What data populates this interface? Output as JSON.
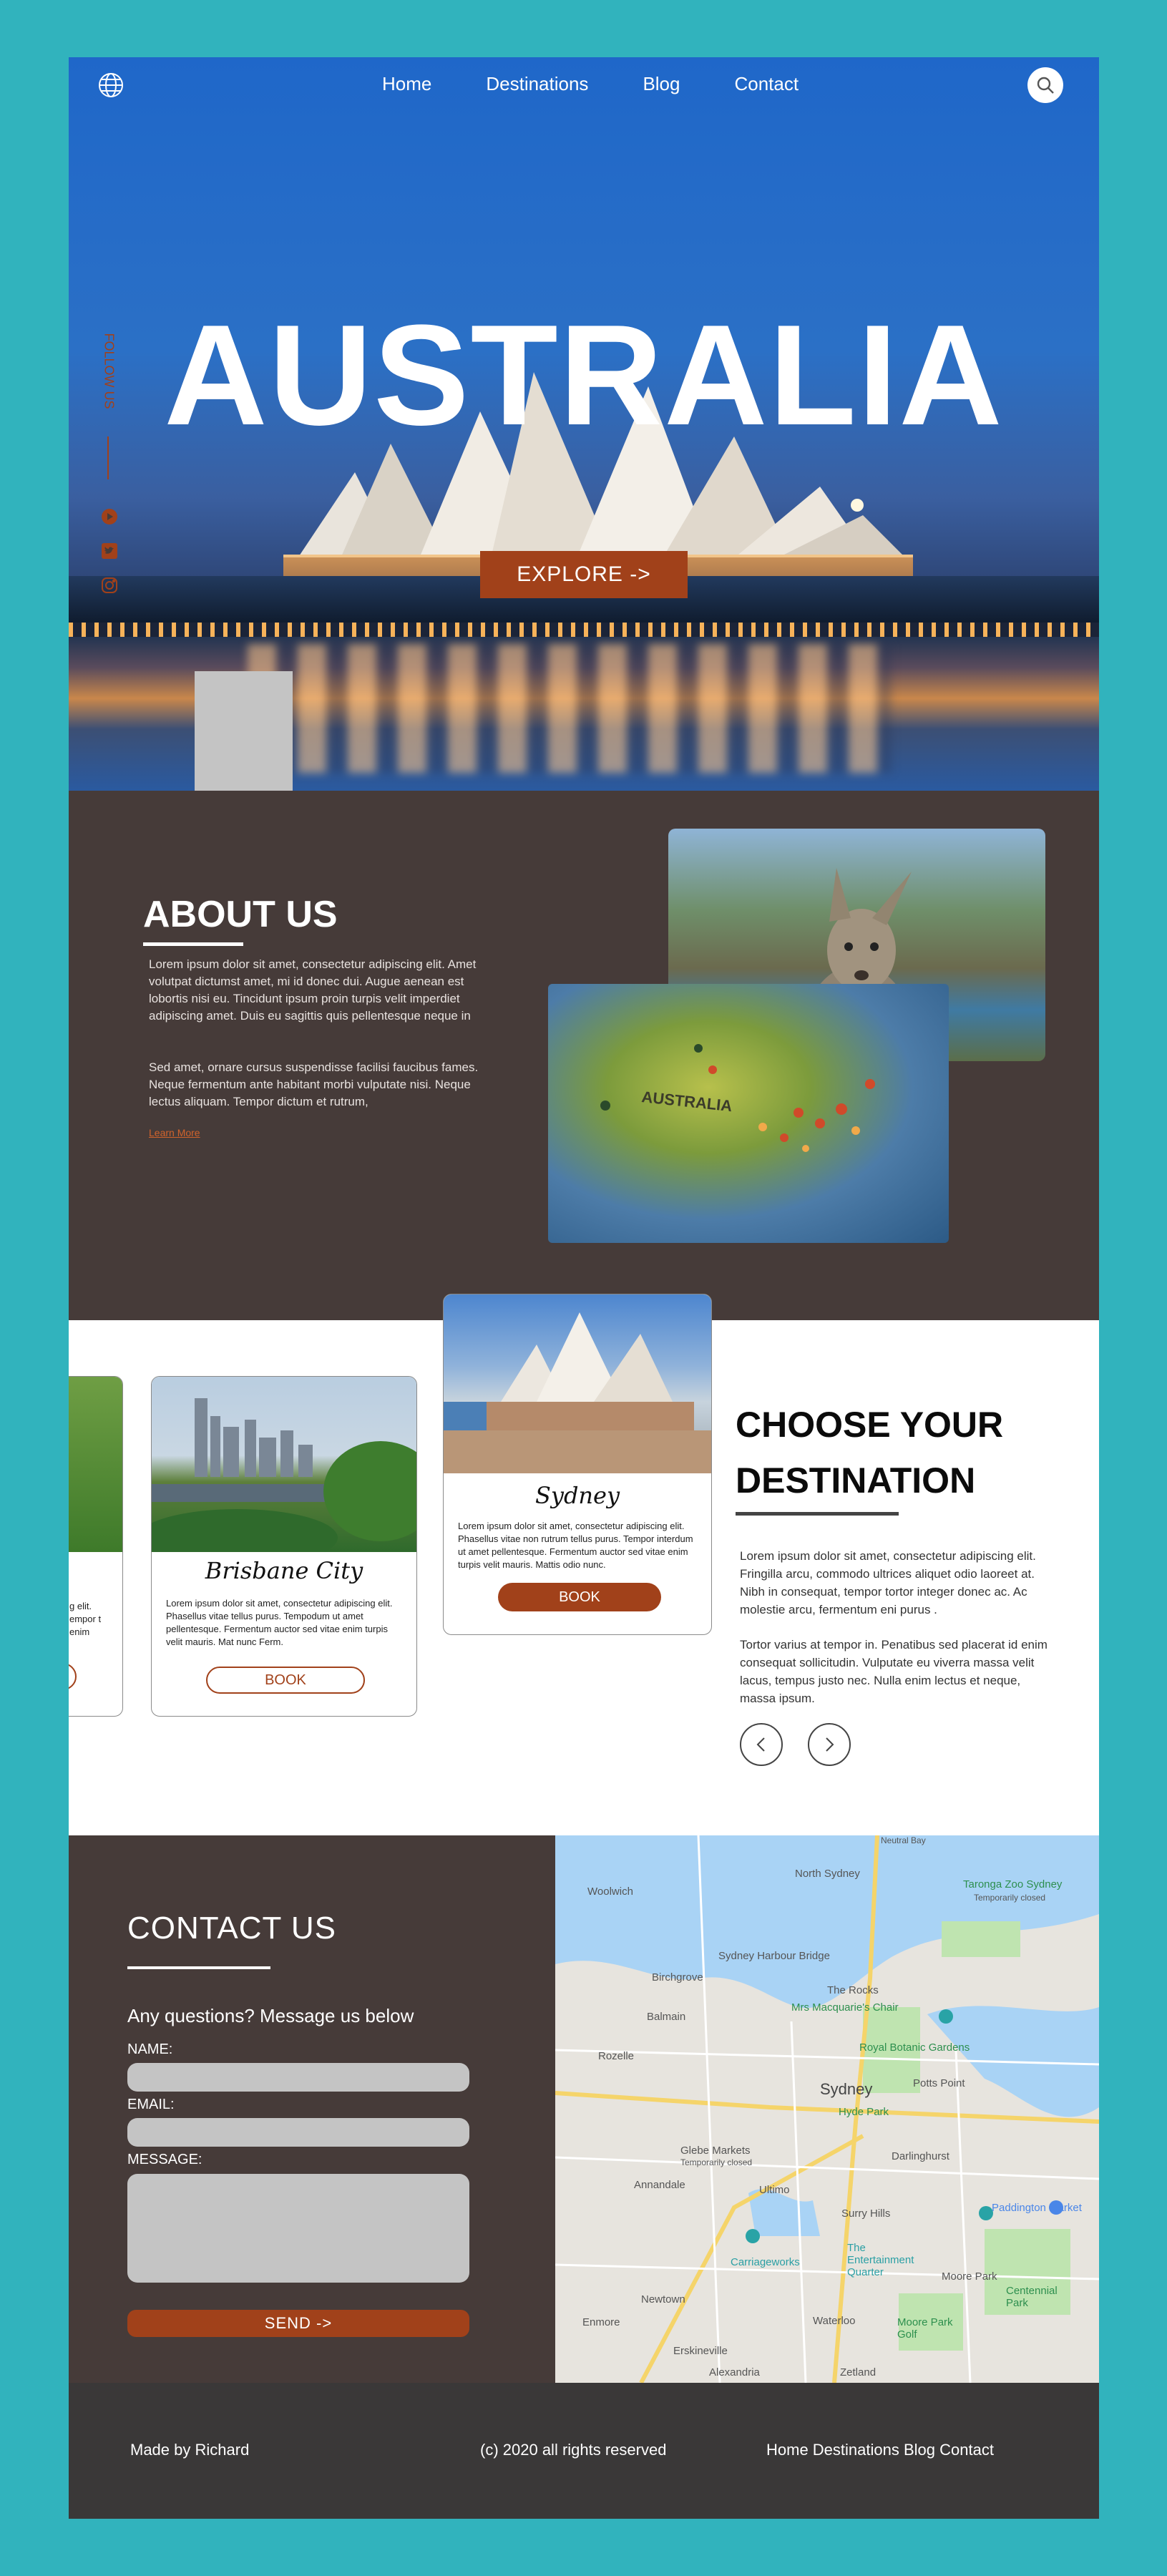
{
  "nav": {
    "links": [
      "Home",
      "Destinations",
      "Blog",
      "Contact"
    ]
  },
  "hero": {
    "title": "AUSTRALIA",
    "explore_label": "EXPLORE ->",
    "follow_label": "FOLLOW US"
  },
  "about": {
    "heading": "ABOUT US",
    "paragraph1": "Lorem ipsum dolor sit amet, consectetur adipiscing elit. Amet volutpat dictumst amet, mi id donec dui. Augue aenean est lobortis nisi eu. Tincidunt ipsum proin turpis velit imperdiet adipiscing amet. Duis eu sagittis quis pellentesque neque in",
    "paragraph2": "Sed amet, ornare cursus suspendisse facilisi faucibus fames. Neque fermentum ante habitant morbi vulputate nisi. Neque lectus aliquam. Tempor dictum et rutrum,",
    "learn_more": "Learn More",
    "map_photo_text": "AUSTRALIA"
  },
  "destinations": {
    "heading_line1": "CHOOSE YOUR",
    "heading_line2": "DESTINATION",
    "paragraph1": "Lorem ipsum dolor sit amet, consectetur adipiscing elit. Fringilla arcu, commodo ultrices aliquet odio laoreet at. Nibh in consequat, tempor tortor integer donec ac. Ac molestie arcu, fermentum eni purus .",
    "paragraph2": "Tortor varius at tempor in. Penatibus sed placerat id enim consequat sollicitudin. Vulputate eu viverra massa velit lacus, tempus justo nec. Nulla enim lectus et neque, massa ipsum.",
    "cards": [
      {
        "name": "",
        "text": "g elit.\nempor\nt enim",
        "book": ""
      },
      {
        "name": "Brisbane City",
        "text": "Lorem ipsum dolor sit amet, consectetur adipiscing elit. Phasellus vitae tellus purus. Tempodum ut amet pellentesque. Fermentum auctor sed vitae enim turpis velit mauris. Mat nunc Ferm.",
        "book": "BOOK"
      },
      {
        "name": "Sydney",
        "text": "Lorem ipsum dolor sit amet, consectetur adipiscing elit. Phasellus vitae non rutrum tellus purus. Tempor interdum ut amet pellentesque. Fermentum auctor sed vitae enim turpis velit mauris. Mattis odio nunc.",
        "book": "BOOK"
      }
    ]
  },
  "contact": {
    "heading": "CONTACT US",
    "prompt": "Any questions? Message us below",
    "name_label": "NAME:",
    "email_label": "EMAIL:",
    "message_label": "MESSAGE:",
    "send_label": "SEND  ->"
  },
  "map": {
    "labels": [
      "Woolwich",
      "North Sydney",
      "Taronga Zoo Sydney",
      "Temporarily closed",
      "Sydney Harbour Bridge",
      "Birchgrove",
      "The Rocks",
      "Balmain",
      "Mrs Macquarie's Chair",
      "Rozelle",
      "Royal Botanic Gardens",
      "Sydney",
      "Potts Point",
      "Hyde Park",
      "Glebe Markets",
      "Temporarily closed",
      "Darlinghurst",
      "Annandale",
      "Ultimo",
      "Paddington Market",
      "Surry Hills",
      "The Entertainment Quarter",
      "Carriageworks",
      "Moore Park",
      "Newtown",
      "Centennial Park",
      "Enmore",
      "Waterloo",
      "Moore Park Golf",
      "Erskineville",
      "Alexandria",
      "Zetland",
      "Neutral Bay"
    ]
  },
  "footer": {
    "made_by": "Made by Richard",
    "copyright": "(c) 2020 all rights reserved",
    "links": "Home Destinations Blog  Contact"
  }
}
